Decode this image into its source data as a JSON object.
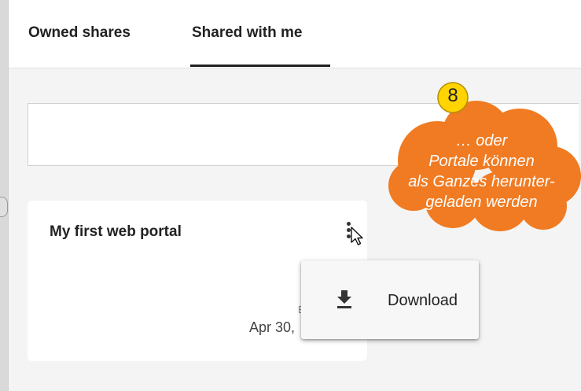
{
  "tabs": {
    "owned": "Owned shares",
    "shared": "Shared with me"
  },
  "portal_card": {
    "title": "My first web portal",
    "ends_label": "En",
    "ends_date": "Apr 30,"
  },
  "context_menu": {
    "download_label": "Download",
    "download_icon": "download-icon"
  },
  "callout": {
    "number": "8",
    "lines": [
      "… oder",
      "Portale können",
      "als Ganzes herunter-",
      "geladen werden"
    ],
    "color": "#f07b22",
    "badge_color": "#ffd400"
  }
}
